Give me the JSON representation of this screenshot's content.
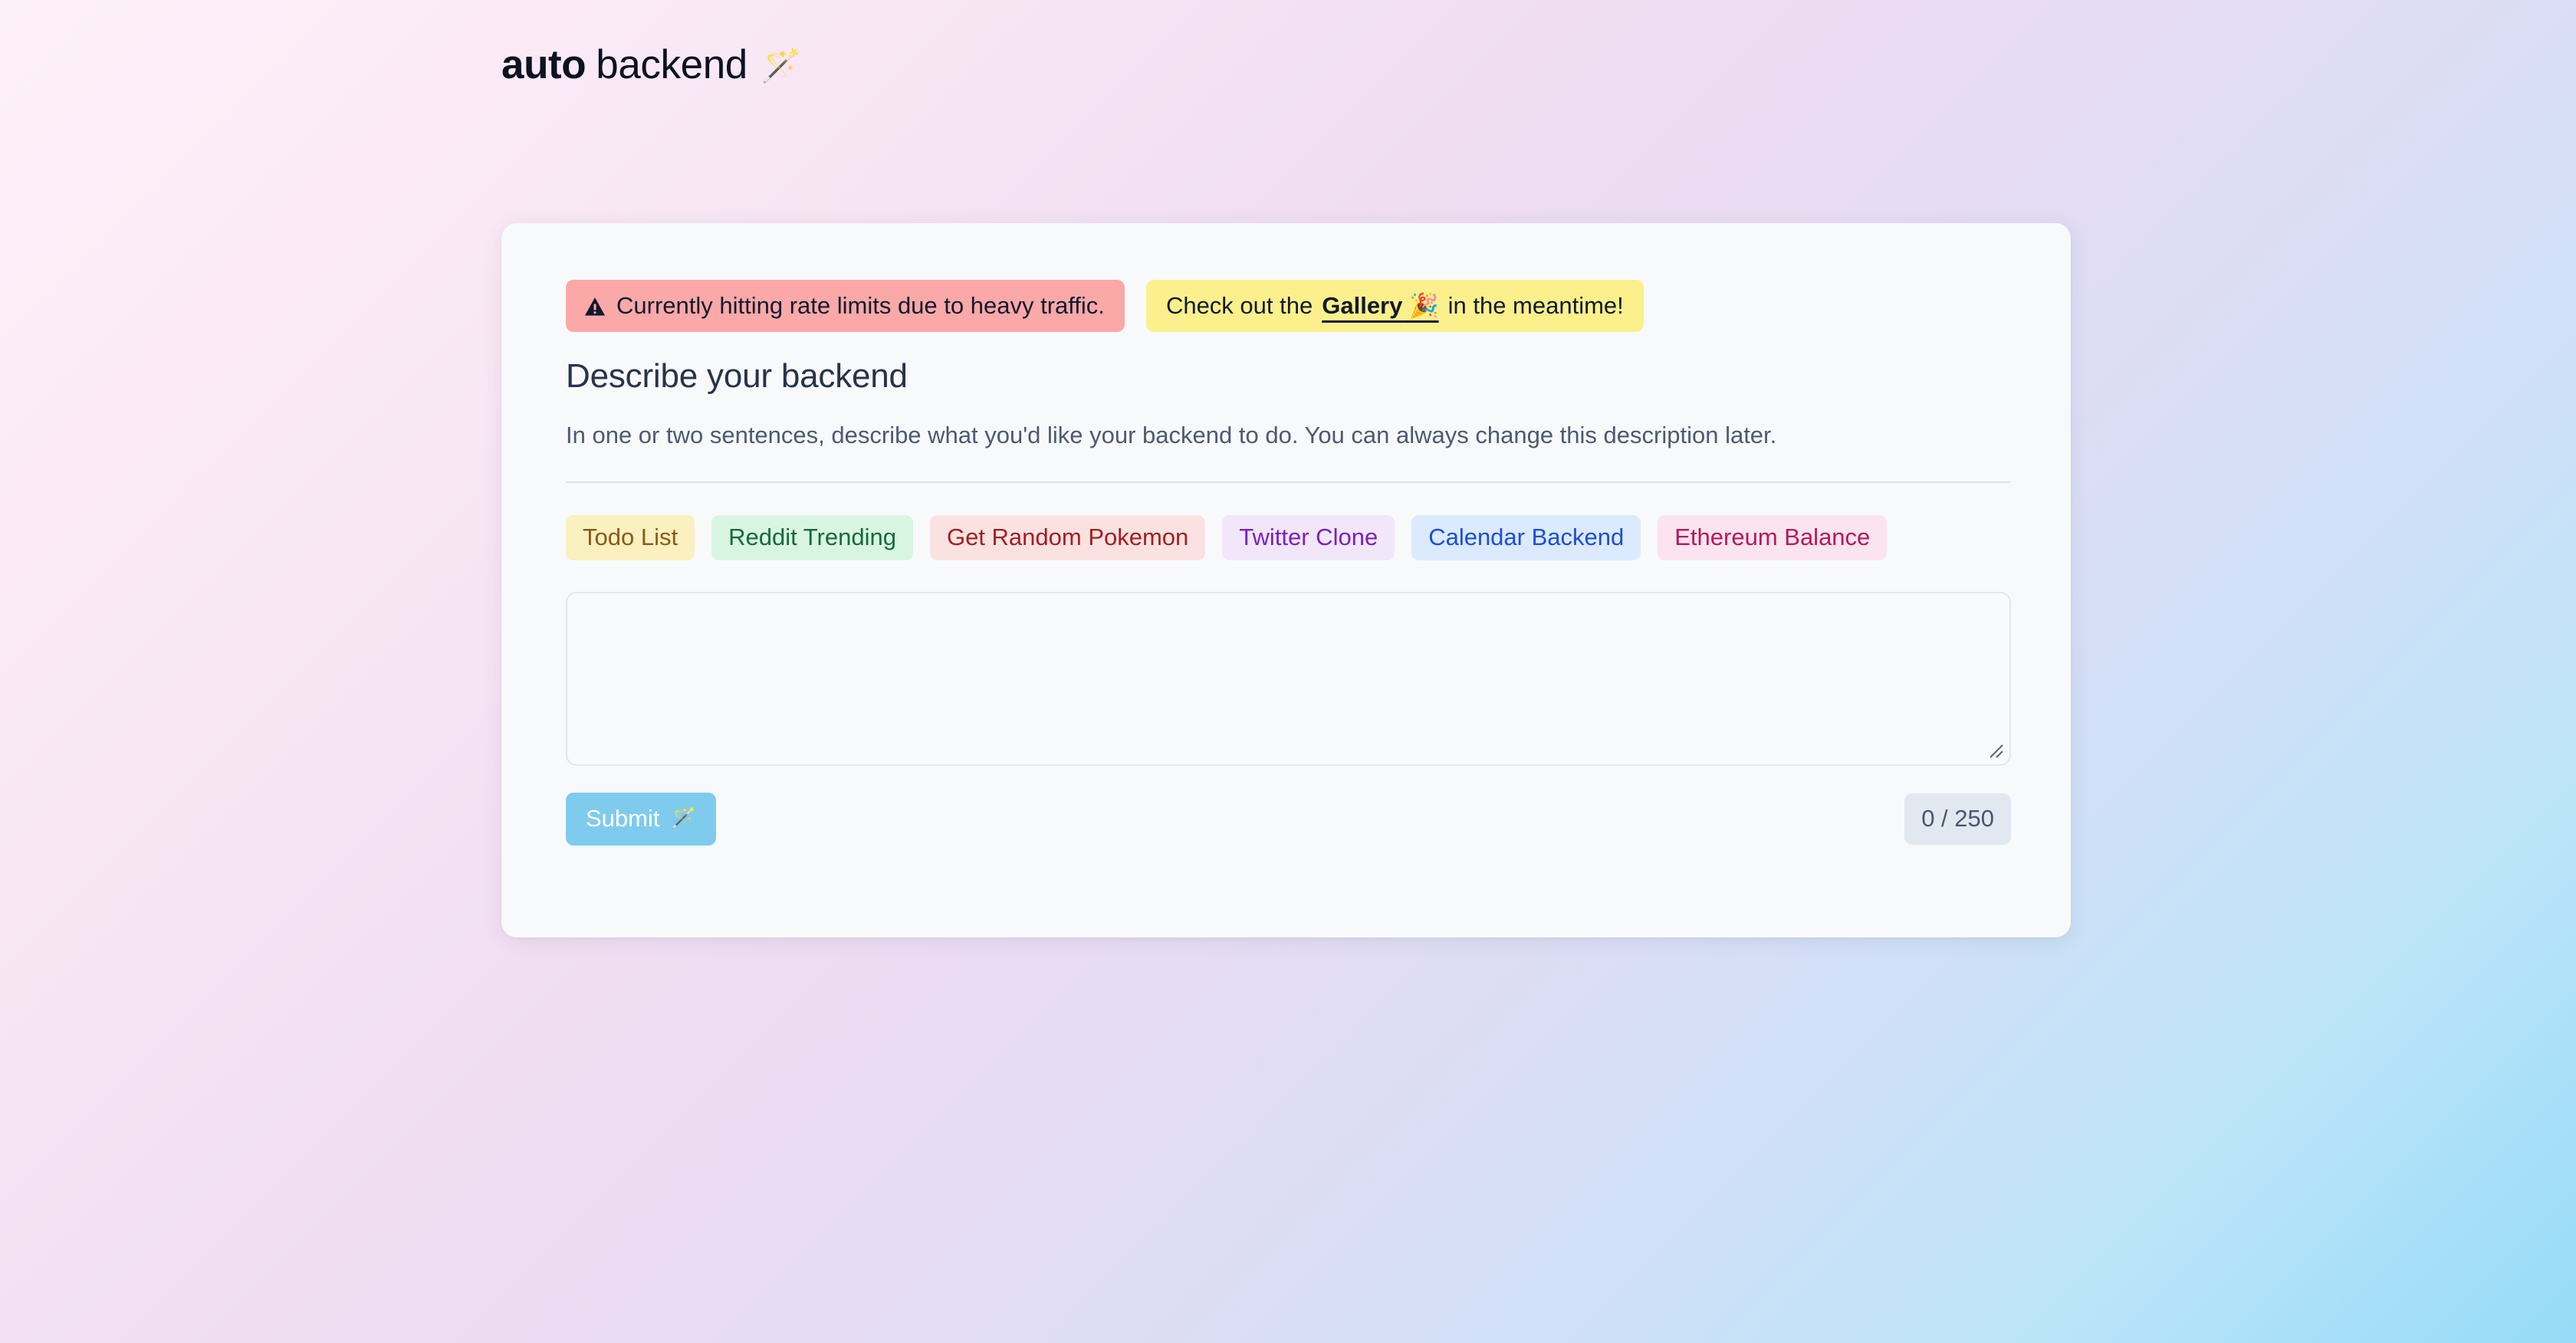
{
  "brand": {
    "word_bold": "auto",
    "word_regular": "backend",
    "wand_icon": "magic-wand-emoji",
    "wand_glyph": "🪄"
  },
  "banners": {
    "warning": {
      "icon": "warning-triangle-icon",
      "text": "Currently hitting rate limits due to heavy traffic.",
      "background": "#fba8a8",
      "text_color": "#111a2e"
    },
    "gallery": {
      "prefix": "Check out the",
      "link_label": "Gallery",
      "link_emoji": "🎉",
      "suffix": "in the meantime!",
      "background": "#fcf08c",
      "text_color": "#111a2e"
    }
  },
  "form": {
    "heading": "Describe your backend",
    "subtitle": "In one or two sentences, describe what you'd like your backend to do. You can always change this description later.",
    "textarea_value": "",
    "textarea_placeholder": "",
    "submit_label": "Submit",
    "submit_wand": "🪄",
    "submit_color": "#7fcbee",
    "counter": "0 / 250",
    "counter_current": 0,
    "counter_max": 250
  },
  "chips": [
    {
      "label": "Todo List",
      "bg": "#faf0c0",
      "fg": "#8a5a14"
    },
    {
      "label": "Reddit Trending",
      "bg": "#d8f5e2",
      "fg": "#19693c"
    },
    {
      "label": "Get Random Pokemon",
      "bg": "#fbe2e2",
      "fg": "#a31f21"
    },
    {
      "label": "Twitter Clone",
      "bg": "#f2e6fb",
      "fg": "#7a22b8"
    },
    {
      "label": "Calendar Backend",
      "bg": "#dbeafe",
      "fg": "#1d4ed8"
    },
    {
      "label": "Ethereum Balance",
      "bg": "#fbe3f0",
      "fg": "#b31a5c"
    }
  ],
  "theme": {
    "card_bg": "#f8f9fb",
    "divider": "#dde2e9",
    "heading_color": "#27334b",
    "subtitle_color": "#4c5a72",
    "bg_top_left": "#fdf0f8",
    "bg_top_right": "#e6e2f5",
    "bg_bottom_left": "#f2d3f0",
    "bg_bottom_right": "#96dbf8"
  }
}
